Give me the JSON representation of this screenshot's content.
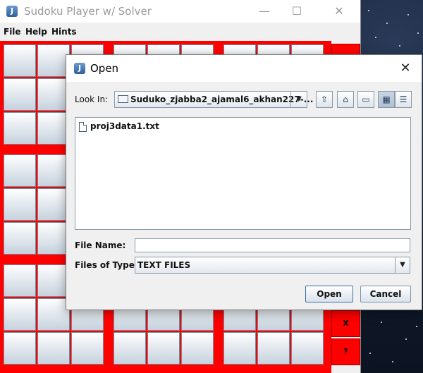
{
  "main_window": {
    "title": "Sudoku Player w/ Solver",
    "caption_buttons": {
      "minimize": "—",
      "maximize": "☐",
      "close": "✕"
    },
    "menu": [
      "File",
      "Help",
      "Hints"
    ],
    "side_buttons": [
      {
        "label": "X"
      },
      {
        "label": "?"
      }
    ]
  },
  "open_dialog": {
    "title": "Open",
    "close_glyph": "✕",
    "look_in_label": "Look In:",
    "look_in_value": "Suduko_zjabba2_ajamal6_akhan227-...",
    "toolbar_icons": [
      "up-folder-icon",
      "home-icon",
      "new-folder-icon",
      "list-view-icon",
      "details-view-icon"
    ],
    "files": [
      "proj3data1.txt"
    ],
    "file_name_label": "File Name:",
    "file_name_value": "",
    "files_of_type_label": "Files of Type:",
    "files_of_type_value": "TEXT FILES",
    "open_button": "Open",
    "cancel_button": "Cancel"
  },
  "colors": {
    "board_border": "#ff0000",
    "cell_gradient_top": "#ffffff",
    "cell_gradient_bottom": "#c6d2de"
  }
}
